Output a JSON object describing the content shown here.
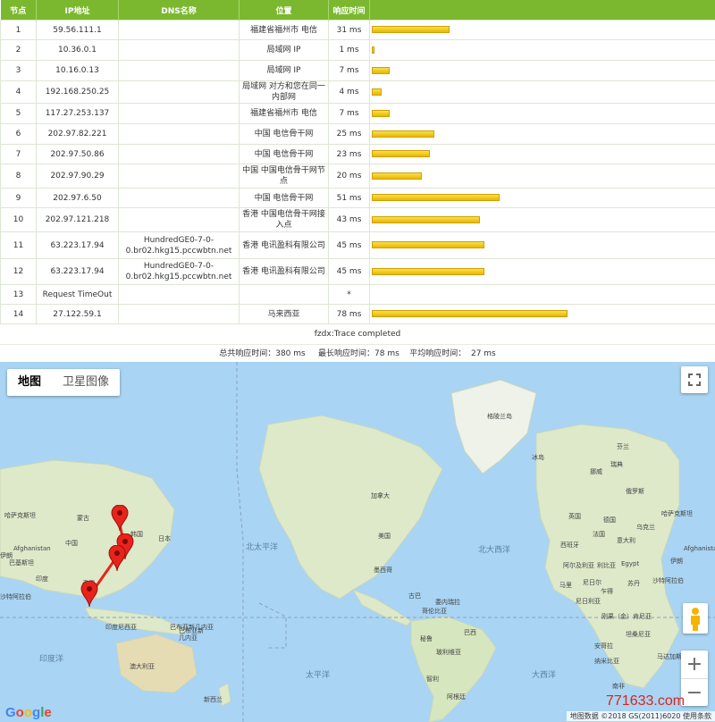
{
  "table": {
    "headers": [
      "节点",
      "IP地址",
      "DNS名称",
      "位置",
      "响应时间"
    ],
    "rows": [
      {
        "n": "1",
        "ip": "59.56.111.1",
        "dns": "",
        "loc": "福建省福州市 电信",
        "t": "31 ms",
        "ms": 31
      },
      {
        "n": "2",
        "ip": "10.36.0.1",
        "dns": "",
        "loc": "局域网 IP",
        "t": "1 ms",
        "ms": 1
      },
      {
        "n": "3",
        "ip": "10.16.0.13",
        "dns": "",
        "loc": "局域网 IP",
        "t": "7 ms",
        "ms": 7
      },
      {
        "n": "4",
        "ip": "192.168.250.25",
        "dns": "",
        "loc": "局域网 对方和您在同一内部网",
        "t": "4 ms",
        "ms": 4
      },
      {
        "n": "5",
        "ip": "117.27.253.137",
        "dns": "",
        "loc": "福建省福州市 电信",
        "t": "7 ms",
        "ms": 7
      },
      {
        "n": "6",
        "ip": "202.97.82.221",
        "dns": "",
        "loc": "中国 电信骨干网",
        "t": "25 ms",
        "ms": 25
      },
      {
        "n": "7",
        "ip": "202.97.50.86",
        "dns": "",
        "loc": "中国 电信骨干网",
        "t": "23 ms",
        "ms": 23
      },
      {
        "n": "8",
        "ip": "202.97.90.29",
        "dns": "",
        "loc": "中国 中国电信骨干网节点",
        "t": "20 ms",
        "ms": 20
      },
      {
        "n": "9",
        "ip": "202.97.6.50",
        "dns": "",
        "loc": "中国 电信骨干网",
        "t": "51 ms",
        "ms": 51
      },
      {
        "n": "10",
        "ip": "202.97.121.218",
        "dns": "",
        "loc": "香港 中国电信骨干网接入点",
        "t": "43 ms",
        "ms": 43
      },
      {
        "n": "11",
        "ip": "63.223.17.94",
        "dns": "HundredGE0-7-0-0.br02.hkg15.pccwbtn.net",
        "loc": "香港 电讯盈科有限公司",
        "t": "45 ms",
        "ms": 45
      },
      {
        "n": "12",
        "ip": "63.223.17.94",
        "dns": "HundredGE0-7-0-0.br02.hkg15.pccwbtn.net",
        "loc": "香港 电讯盈科有限公司",
        "t": "45 ms",
        "ms": 45
      },
      {
        "n": "13",
        "ip": "Request TimeOut",
        "dns": "",
        "loc": "",
        "t": "*",
        "ms": 0
      },
      {
        "n": "14",
        "ip": "27.122.59.1",
        "dns": "",
        "loc": "马来西亚",
        "t": "78 ms",
        "ms": 78
      }
    ]
  },
  "footer": {
    "completed": "fzdx:Trace completed",
    "summary": "总共响应时间：380 ms     最长响应时间：78 ms    平均响应时间：  27 ms"
  },
  "map": {
    "type_buttons": [
      "地图",
      "卫星图像"
    ],
    "oceans": [
      "北太平洋",
      "北大西洋",
      "印度洋",
      "太平洋",
      "大西洋"
    ],
    "labels": [
      "格陵兰岛",
      "冰岛",
      "加拿大",
      "美国",
      "墨西哥",
      "古巴",
      "委内瑞拉",
      "哥伦比亚",
      "秘鲁",
      "巴西",
      "玻利维亚",
      "智利",
      "阿根廷",
      "蒙古",
      "中国",
      "日本",
      "韩国",
      "泰国",
      "印度尼西亚",
      "巴布亚新几内亚",
      "澳大利亚",
      "新西兰",
      "哈萨克斯坦",
      "Afghanistan",
      "巴基斯坦",
      "印度",
      "伊朗",
      "沙特阿拉伯",
      "俄罗斯",
      "芬兰",
      "挪威",
      "瑞典",
      "英国",
      "德国",
      "法国",
      "西班牙",
      "意大利",
      "乌克兰",
      "哈萨克斯坦",
      "Afghanistan",
      "伊朗",
      "沙特阿拉伯",
      "阿尔及利亚",
      "利比亚",
      "Egypt",
      "苏丹",
      "尼日尔",
      "马里",
      "乍得",
      "尼日利亚",
      "刚果（金）",
      "肯尼亚",
      "坦桑尼亚",
      "安哥拉",
      "纳米比亚",
      "南非",
      "马达加斯加",
      "巴布亚新",
      "几内亚"
    ],
    "google": "Google",
    "attribution": "地图数据 ©2018 GS(2011)6020   使用条款",
    "zoom_in": "+",
    "zoom_out": "−"
  },
  "watermark": "771633.com",
  "colors": {
    "header_green": "#7cb82f",
    "bar_yellow": "#f2c600",
    "route_red": "#e8231c",
    "ocean": "#a9d4f3",
    "land": "#e3ecd6"
  }
}
